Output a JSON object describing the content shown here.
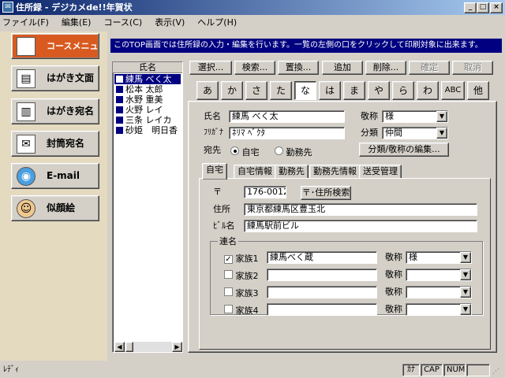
{
  "window": {
    "title": "住所録 - デジカメde!!年賀状",
    "min": "_",
    "max": "□",
    "close": "×"
  },
  "menu": [
    "ファイル(F)",
    "編集(E)",
    "コース(C)",
    "表示(V)",
    "ヘルプ(H)"
  ],
  "nav": {
    "course_menu": "コースメニュー",
    "items": [
      {
        "label": "はがき文面",
        "icon": "postcard-icon"
      },
      {
        "label": "はがき宛名",
        "icon": "address-icon"
      },
      {
        "label": "封筒宛名",
        "icon": "envelope-icon"
      },
      {
        "label": "E-mail",
        "icon": "globe-icon"
      },
      {
        "label": "似顔絵",
        "icon": "face-icon"
      }
    ]
  },
  "info": "このTOP画面では住所録の入力・編集を行います。一覧の左側の口をクリックして印刷対象に出来ます。",
  "namelist": {
    "header": "氏名",
    "items": [
      "練馬 べく太",
      "松本 太郎",
      "水野 重美",
      "火野 レイ",
      "三条 レイカ",
      "砂姫　明日香"
    ],
    "selected": 0
  },
  "toolbar": {
    "select": "選択...",
    "search": "検索...",
    "replace": "置換...",
    "add": "追加",
    "delete": "削除...",
    "confirm": "確定",
    "cancel": "取消"
  },
  "kana": [
    "あ",
    "か",
    "さ",
    "た",
    "な",
    "は",
    "ま",
    "や",
    "ら",
    "わ",
    "ABC",
    "他"
  ],
  "kana_selected": 4,
  "form": {
    "name_label": "氏名",
    "name_value": "練馬 べく太",
    "honor_label": "敬称",
    "honor_value": "様",
    "kana_label": "ﾌﾘｶﾞﾅ",
    "kana_value": "ﾈﾘﾏ ﾍﾞｸﾀ",
    "class_label": "分類",
    "class_value": "仲間",
    "dest_label": "宛先",
    "dest_home": "自宅",
    "dest_work": "勤務先",
    "edit_btn": "分類/敬称の編集..."
  },
  "tabs": [
    "自宅",
    "自宅情報",
    "勤務先",
    "勤務先情報",
    "送受管理"
  ],
  "home": {
    "zip_label": "〒",
    "zip_value": "176-0012",
    "zip_search": "〒･住所検索",
    "addr_label": "住所",
    "addr_value": "東京都練馬区豊玉北",
    "bldg_label": "ﾋﾞﾙ名",
    "bldg_value": "練馬駅前ビル",
    "group_label": "連名",
    "rows": [
      {
        "checked": true,
        "mark": "✓",
        "label": "家族1",
        "value": "練馬べく蔵",
        "honor_label": "敬称",
        "honor": "様"
      },
      {
        "checked": false,
        "mark": "",
        "label": "家族2",
        "value": "",
        "honor_label": "敬称",
        "honor": ""
      },
      {
        "checked": false,
        "mark": "",
        "label": "家族3",
        "value": "",
        "honor_label": "敬称",
        "honor": ""
      },
      {
        "checked": false,
        "mark": "",
        "label": "家族4",
        "value": "",
        "honor_label": "敬称",
        "honor": ""
      }
    ]
  },
  "status": {
    "text": "ﾚﾃﾞｨ",
    "kana": "ｶﾅ",
    "cap": "CAP",
    "num": "NUM"
  }
}
